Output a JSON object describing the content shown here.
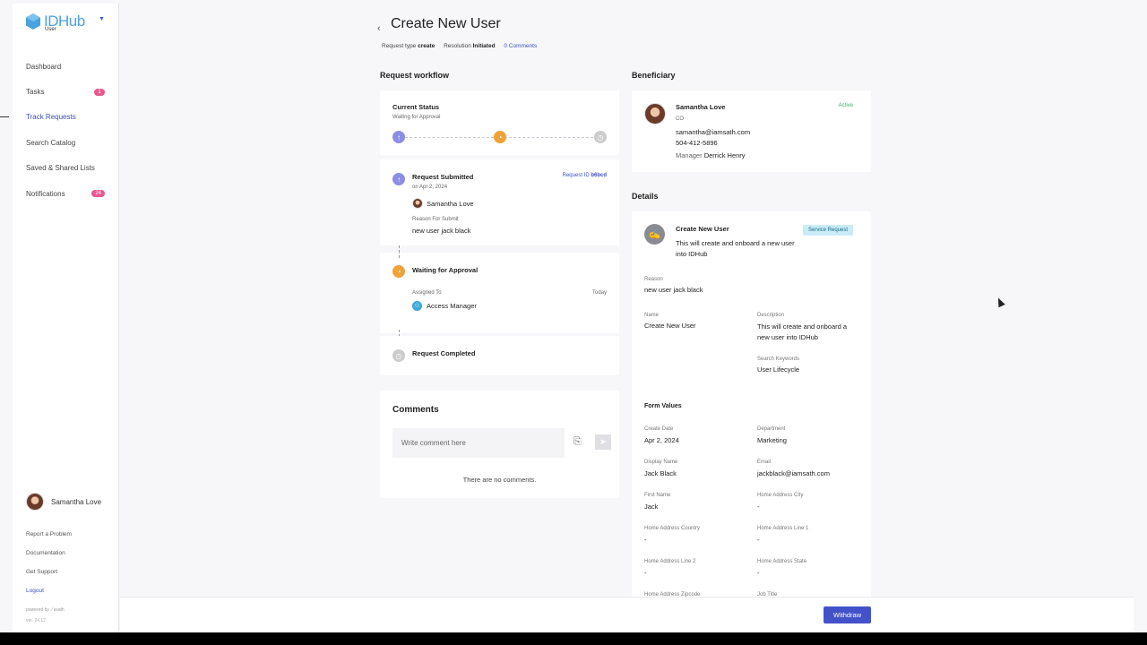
{
  "app": {
    "logo_text": "IDHub",
    "logo_sub": "User",
    "powered_by": "powered by ⟋ssath",
    "version": "ver. 24.12"
  },
  "sidebar": {
    "items": [
      {
        "label": "Dashboard",
        "badge": ""
      },
      {
        "label": "Tasks",
        "badge": "1"
      },
      {
        "label": "Track Requests",
        "badge": ""
      },
      {
        "label": "Search Catalog",
        "badge": ""
      },
      {
        "label": "Saved & Shared Lists",
        "badge": ""
      },
      {
        "label": "Notifications",
        "badge": "24"
      }
    ],
    "user_name": "Samantha Love",
    "links": [
      "Report a Problem",
      "Documentation",
      "Get Support",
      "Logout"
    ]
  },
  "header": {
    "title": "Create New User",
    "request_type_label": "Request type",
    "request_type": "create",
    "resolution_label": "Resolution",
    "resolution": "Initiated",
    "comments_link": "0 Comments"
  },
  "workflow": {
    "section_title": "Request workflow",
    "current_status_label": "Current Status",
    "current_status": "Waiting for Approval",
    "submitted": {
      "title": "Request Submitted",
      "date": "on Apr 2, 2024",
      "request_id_label": "Request ID",
      "request_id": "b6bcd",
      "user": "Samantha Love",
      "reason_label": "Reason For Submit",
      "reason": "new user jack black"
    },
    "approval": {
      "title": "Waiting for Approval",
      "assigned_label": "Assigned To",
      "assigned_when": "Today",
      "assignee": "Access Manager"
    },
    "completed": {
      "title": "Request Completed"
    }
  },
  "comments": {
    "title": "Comments",
    "placeholder": "Write comment here",
    "empty": "There are no comments."
  },
  "beneficiary": {
    "section_title": "Beneficiary",
    "name": "Samantha Love",
    "status": "Active",
    "title": "CO",
    "email": "samantha@iamsath.com",
    "phone": "504-412-5896",
    "manager_label": "Manager",
    "manager": "Derrick Henry"
  },
  "details": {
    "section_title": "Details",
    "item_title": "Create New User",
    "item_desc": "This will create and onboard a new user into IDHub",
    "tag": "Service Request",
    "reason_label": "Reason",
    "reason": "new user jack black",
    "name_label": "Name",
    "name": "Create New User",
    "description_label": "Description",
    "description": "This will create and onboard a new user into IDHub",
    "keywords_label": "Search Keywords",
    "keywords": "User Lifecycle",
    "form_values_title": "Form Values",
    "fields": [
      {
        "label": "Create Date",
        "value": "Apr 2, 2024"
      },
      {
        "label": "Department",
        "value": "Marketing"
      },
      {
        "label": "Display Name",
        "value": "Jack Black"
      },
      {
        "label": "Email",
        "value": "jackblack@iamsath.com"
      },
      {
        "label": "First Name",
        "value": "Jack"
      },
      {
        "label": "Home Address City",
        "value": "-"
      },
      {
        "label": "Home Address Country",
        "value": "-"
      },
      {
        "label": "Home Address Line 1",
        "value": "-"
      },
      {
        "label": "Home Address Line 2",
        "value": "-"
      },
      {
        "label": "Home Address State",
        "value": "-"
      },
      {
        "label": "Home Address Zipcode",
        "value": ""
      },
      {
        "label": "Job Title",
        "value": ""
      }
    ]
  },
  "footer": {
    "withdraw_label": "Withdraw"
  }
}
